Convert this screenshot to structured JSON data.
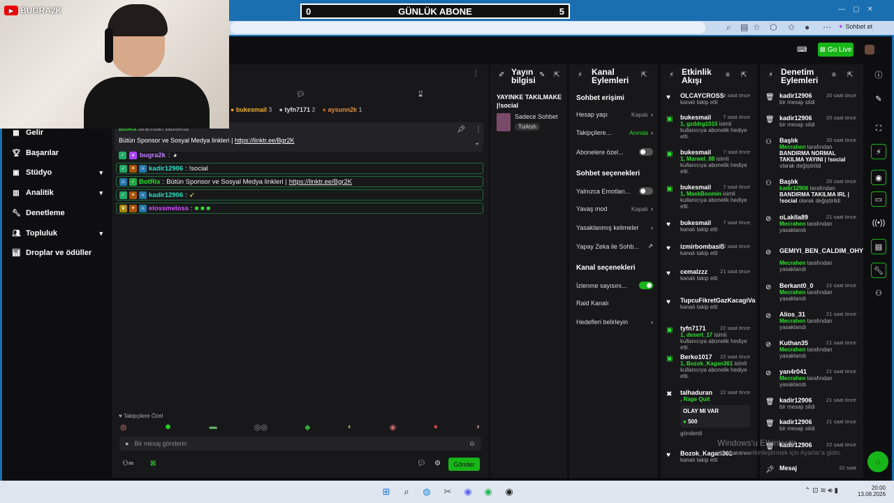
{
  "scoreboard": {
    "left": "0",
    "title": "GÜNLÜK ABONE",
    "right": "5"
  },
  "browser": {
    "chat_label": "Sohbet et"
  },
  "header": {
    "go_live": "Go Live"
  },
  "webcam": {
    "channel": "BUGRA2K"
  },
  "sidebar": {
    "items": [
      {
        "label": "Gelir",
        "icon": "revenue-icon"
      },
      {
        "label": "Başarılar",
        "icon": "trophy-icon"
      },
      {
        "label": "Stüdyo",
        "icon": "studio-icon"
      },
      {
        "label": "Analitik",
        "icon": "analytics-icon"
      },
      {
        "label": "Denetleme",
        "icon": "wrench-icon"
      },
      {
        "label": "Topluluk",
        "icon": "community-icon"
      },
      {
        "label": "Droplar ve ödüller",
        "icon": "drops-icon"
      }
    ]
  },
  "chat": {
    "top_gifters": [
      {
        "name": "bukesmail",
        "count": "3"
      },
      {
        "name": "tyfn7171",
        "count": "2"
      },
      {
        "name": "aysunn2k",
        "count": "1"
      }
    ],
    "pinned_by": "tarafından sabitlendi",
    "pinned_author": "BotRix",
    "pinned_text": "Bütün Sponsor ve Sosyal Medya linkleri |",
    "pinned_link": "https://linktr.ee/Bgr2K",
    "messages": [
      {
        "user": "bugra2k",
        "text": "",
        "color": "#c080ff"
      },
      {
        "user": "kadir12906",
        "text": "!social",
        "color": "#2ce0c0"
      },
      {
        "user": "BotRix",
        "text": "Bütün Sponsor ve Sosyal Medya linkleri |",
        "link": "https://linktr.ee/Bgr2K",
        "color": "#2ce02c"
      },
      {
        "user": "kadir12906",
        "text": "",
        "color": "#2ce0c0"
      },
      {
        "user": "elossmeloss",
        "text": "",
        "color": "#d050ff"
      }
    ],
    "emote_label": "Takipçilere Özel",
    "input_placeholder": "Bir mesaj gönderin",
    "send": "Gönder"
  },
  "stream_info": {
    "title_line1": "Yayın",
    "title_line2": "bilgisi",
    "stream_title": "YAYINKE TAKILMAKE |!social",
    "category": "Sadece Sohbet",
    "tag": "Turkish"
  },
  "channel_actions": {
    "title_line1": "Kanal",
    "title_line2": "Eylemleri",
    "chat_access": "Sohbet erişimi",
    "account_age": "Hesap yaşı",
    "account_age_val": "Kapalı",
    "followers": "Takipçilere...",
    "followers_val": "Anında",
    "subscribers": "Abonelere özel...",
    "chat_options": "Sohbet seçenekleri",
    "emotes_only": "Yalnızca Emotları...",
    "slow_mode": "Yavaş mod",
    "slow_mode_val": "Kapalı",
    "banned_words": "Yasaklanmış kelimeler",
    "ai_chat": "Yapay Zeka ile Sohb...",
    "channel_options": "Kanal seçenekleri",
    "view_count": "İzlenme sayısını...",
    "raid": "Raid Kanalı",
    "goals": "Hedefleri belirleyin"
  },
  "activity": {
    "title_line1": "Etkinlik",
    "title_line2": "Akışı",
    "items": [
      {
        "user": "OLCAYCROSS",
        "time": "4 saat önce",
        "detail": "kanalı takip etti",
        "icon": "heart-icon"
      },
      {
        "user": "bukesmail",
        "time": "7 saat önce",
        "gift": "1, gzddrg1010",
        "detail": "isimli kullanıcıya abonelik hediye etti.",
        "icon": "gift-icon"
      },
      {
        "user": "bukesmail",
        "time": "7 saat önce",
        "gift": "1, Marwel_88",
        "detail": "isimli kullanıcıya abonelik hediye etti.",
        "icon": "gift-icon"
      },
      {
        "user": "bukesmail",
        "time": "7 saat önce",
        "gift": "1, MaskBoomin",
        "detail": "isimli kullanıcıya abonelik hediye etti.",
        "icon": "gift-icon"
      },
      {
        "user": "bukesmail",
        "time": "7 saat önce",
        "detail": "kanalı takip etti",
        "icon": "heart-icon"
      },
      {
        "user": "izmirbombasi5",
        "time": "20 saat önce",
        "detail": "kanalı takip etti",
        "icon": "heart-icon"
      },
      {
        "user": "cemalzzz",
        "time": "21 saat önce",
        "detail": "kanalı takip etti",
        "icon": "heart-icon"
      },
      {
        "user": "TupcuFikretGazKacagiVa",
        "time": "",
        "detail": "kanalı takip etti",
        "icon": "heart-icon"
      },
      {
        "user": "tyfn7171",
        "time": "22 saat önce",
        "gift": "1, desert_17",
        "detail": "isimli kullanıcıya abonelik hediye etti.",
        "icon": "gift-icon"
      },
      {
        "user": "Berko1017",
        "time": "22 saat önce",
        "gift": "1, Bozok_Kagan361",
        "detail": "isimli kullanıcıya abonelik hediye etti.",
        "icon": "gift-icon"
      },
      {
        "user": "talhaduran",
        "time": "22 saat önce",
        "gift": ", Rage Quit",
        "detail": "gönderdi",
        "icon": "kick-icon",
        "card_title": "OLAY MI VAR",
        "card_amount": "500"
      },
      {
        "user": "Bozok_Kagan361",
        "time": "22 saat önce",
        "detail": "kanalı takip etti",
        "icon": "heart-icon"
      }
    ]
  },
  "mod_actions": {
    "title_line1": "Denetim",
    "title_line2": "Eylemleri",
    "items": [
      {
        "user": "kadir12906",
        "time": "20 saat önce",
        "detail": "bir mesajı sildi",
        "icon": "trash-icon"
      },
      {
        "user": "kadir12906",
        "time": "20 saat önce",
        "detail": "bir mesajı sildi",
        "icon": "trash-icon"
      },
      {
        "user": "Başlık",
        "time": "20 saat önce",
        "by": "Mecrahen",
        "detail": "tarafından",
        "extra": "BANDIRMA NORMAL TAKILMA YAYINI | !social",
        "tail": "olarak değiştirildi",
        "icon": "title-icon"
      },
      {
        "user": "Başlık",
        "time": "20 saat önce",
        "by": "kadir12906",
        "detail": "tarafından",
        "extra": "BANDIRMA TAKILMA IRL | !social",
        "tail": "olarak değiştirildi",
        "icon": "title-icon"
      },
      {
        "user": "oLaklla89",
        "time": "21 saat önce",
        "by": "Mecrahen",
        "detail": "tarafından yasaklandı",
        "icon": "ban-icon"
      },
      {
        "user": "GEMIYI_BEN_CALDIM_OHY",
        "time": "",
        "by": "Mecrahen",
        "detail": "tarafından yasaklandı",
        "icon": "ban-icon"
      },
      {
        "user": "Berkant0_0",
        "time": "21 saat önce",
        "by": "Mecrahen",
        "detail": "tarafından yasaklandı",
        "icon": "ban-icon"
      },
      {
        "user": "Alios_31",
        "time": "21 saat önce",
        "by": "Mecrahen",
        "detail": "tarafından yasaklandı",
        "icon": "ban-icon"
      },
      {
        "user": "Kuthan35",
        "time": "21 saat önce",
        "by": "Mecrahen",
        "detail": "tarafından yasaklandı",
        "icon": "ban-icon"
      },
      {
        "user": "yan4r041",
        "time": "21 saat önce",
        "by": "Mecrahen",
        "detail": "tarafından yasaklandı",
        "icon": "ban-icon"
      },
      {
        "user": "kadir12906",
        "time": "21 saat önce",
        "detail": "bir mesajı sildi",
        "icon": "trash-icon"
      },
      {
        "user": "kadir12906",
        "time": "21 saat önce",
        "detail": "bir mesajı sildi",
        "icon": "trash-icon"
      },
      {
        "user": "kadir12906",
        "time": "22 saat önce",
        "detail": "",
        "icon": "trash-icon"
      },
      {
        "user": "Mesaj",
        "time": "22 saat",
        "detail": "",
        "icon": "pin-icon"
      }
    ]
  },
  "watermark": {
    "line1": "Windows'u Etkinleştir",
    "line2": "Windows'u etkinleştirmek için Ayarlar'a gidin."
  },
  "clock": {
    "time": "20:00",
    "date": "13.08.2026"
  },
  "colors": {
    "accent": "#18b518",
    "chat_bg": "#18181b",
    "app_bg": "#0e0e10"
  }
}
